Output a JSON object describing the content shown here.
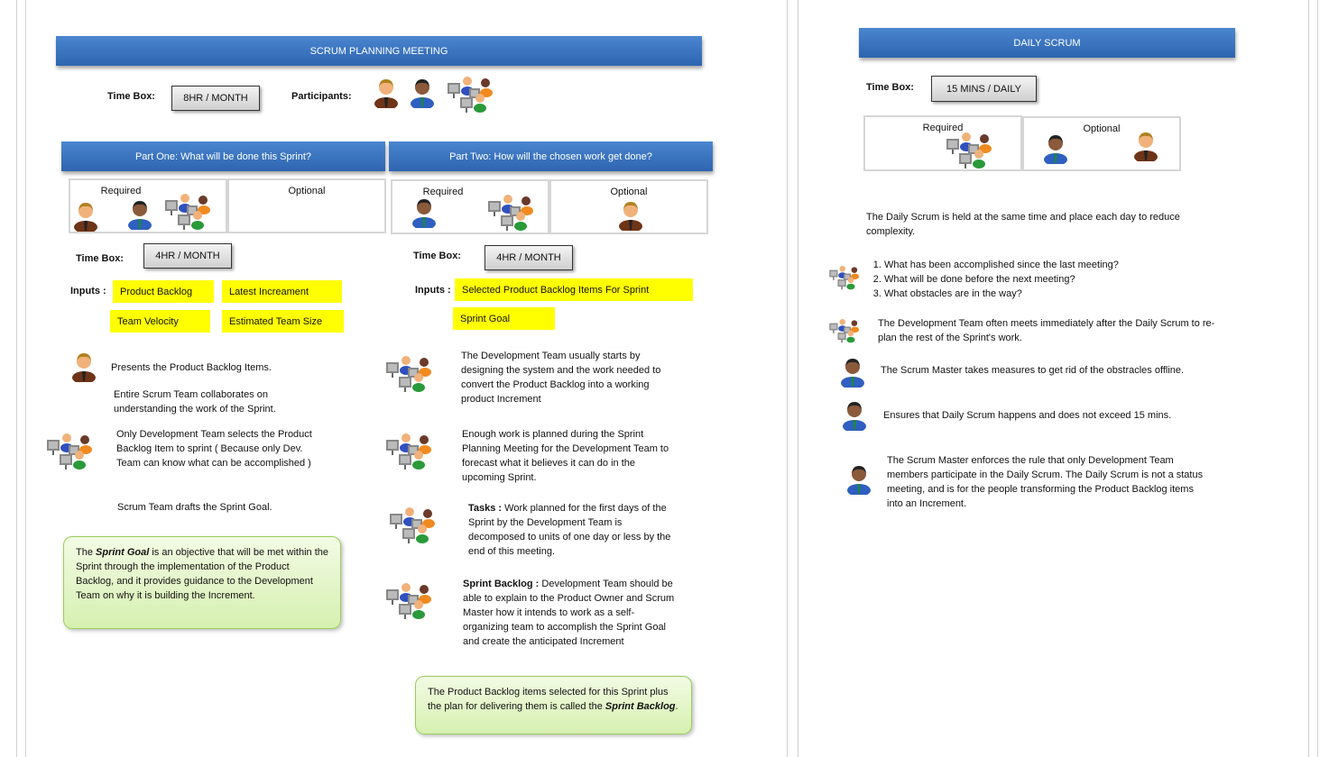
{
  "planning": {
    "title": "SCRUM PLANNING MEETING",
    "timebox_label": "Time Box:",
    "timebox_value": "8HR / MONTH",
    "participants_label": "Participants:",
    "participants_icons": [
      "product-owner-icon",
      "scrum-master-icon",
      "development-team-icon"
    ],
    "part_one": {
      "title": "Part One: What will be done this Sprint?",
      "required_label": "Required",
      "optional_label": "Optional",
      "timebox_label": "Time Box:",
      "timebox_value": "4HR / MONTH",
      "inputs_label": "Inputs :",
      "inputs": [
        "Product Backlog",
        "Latest Increament",
        "Team Velocity",
        "Estimated  Team Size"
      ],
      "steps": [
        "Presents the Product Backlog Items.",
        "Entire Scrum Team collaborates on understanding the work of the Sprint.",
        "Only Development Team selects the Product Backlog Item to sprint ( Because only Dev. Team can know what can be accomplished )",
        "Scrum Team drafts the Sprint Goal."
      ],
      "note": {
        "pre": "The ",
        "em": "Sprint Goal",
        "post": " is an objective that will be met within the Sprint through the implementation of the Product Backlog, and it provides guidance to the Development Team on why it is building the Increment."
      }
    },
    "part_two": {
      "title": "Part Two: How will the chosen work get done?",
      "required_label": "Required",
      "optional_label": "Optional",
      "timebox_label": "Time Box:",
      "timebox_value": "4HR / MONTH",
      "inputs_label": "Inputs :",
      "inputs": [
        "Selected Product Backlog Items For Sprint",
        "Sprint Goal"
      ],
      "steps": [
        {
          "bold": "",
          "text": "The Development Team usually starts by designing the system and the work needed to convert the Product Backlog into a working product Increment"
        },
        {
          "bold": "",
          "text": "Enough work is planned during the Sprint Planning Meeting for the Development Team to forecast what it believes it can do in the upcoming Sprint."
        },
        {
          "bold": "Tasks  :",
          "text": " Work planned for the first days of the Sprint by the Development Team is decomposed to units of one day or less by the end of this meeting."
        },
        {
          "bold": "Sprint Backlog  :",
          "text": " Development Team should be able to explain to the Product Owner and Scrum Master how it intends to work as a self-organizing team to accomplish the Sprint Goal and create the anticipated Increment"
        }
      ],
      "note": {
        "pre": "The Product Backlog items selected for this Sprint plus the plan for delivering them is called the ",
        "em": "Sprint Backlog",
        "post": "."
      }
    }
  },
  "daily": {
    "title": "DAILY SCRUM",
    "timebox_label": "Time Box:",
    "timebox_value": "15 MINS / DAILY",
    "required_label": "Required",
    "optional_label": "Optional",
    "intro": "The Daily Scrum is held at the same time and place each day to reduce complexity.",
    "questions": [
      "What has been accomplished since the last meeting?",
      "What will be done before the next meeting?",
      "What obstacles are in the way?"
    ],
    "notes": [
      "The Development Team often meets immediately after the Daily Scrum to re-plan the rest of the Sprint's work.",
      "The Scrum Master takes measures to get rid of the obstracles offline.",
      "Ensures that Daily Scrum happens and does not exceed 15 mins.",
      "The Scrum Master enforces the rule that only Development Team members participate in the Daily Scrum. The Daily Scrum is not a status meeting, and is for the people transforming the Product Backlog items into an Increment."
    ]
  },
  "colors": {
    "header": "#3a74c0",
    "input_highlight": "#ffff00",
    "note_bg": "#e4f5cc",
    "product_owner": "#7a3a1a",
    "scrum_master": "#2f5fc0"
  }
}
